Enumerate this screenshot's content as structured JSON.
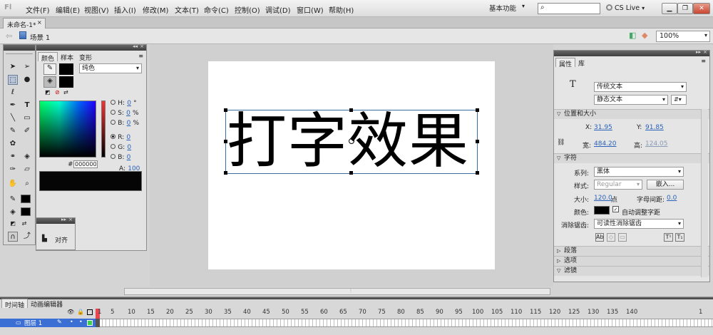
{
  "app": {
    "logo": "Fl",
    "menus": [
      "文件(F)",
      "编辑(E)",
      "视图(V)",
      "插入(I)",
      "修改(M)",
      "文本(T)",
      "命令(C)",
      "控制(O)",
      "调试(D)",
      "窗口(W)",
      "帮助(H)"
    ],
    "workspace": "基本功能",
    "cslive": "CS Live"
  },
  "document": {
    "tab": "未命名-1*",
    "scene": "场景 1",
    "zoom": "100%"
  },
  "color_panel": {
    "tabs": [
      "颜色",
      "样本",
      "变形"
    ],
    "fill_type": "纯色",
    "hsb": [
      {
        "k": "H:",
        "v": "0",
        "u": "°"
      },
      {
        "k": "S:",
        "v": "0",
        "u": "%"
      },
      {
        "k": "B:",
        "v": "0",
        "u": "%"
      }
    ],
    "rgb": [
      {
        "k": "R:",
        "v": "0"
      },
      {
        "k": "G:",
        "v": "0"
      },
      {
        "k": "B:",
        "v": "0"
      }
    ],
    "alpha_label": "A:",
    "alpha": "100",
    "alpha_unit": "%",
    "hex_prefix": "#",
    "hex": "000000",
    "align_label": "对齐"
  },
  "stage": {
    "text": "打字效果"
  },
  "properties": {
    "tabs": [
      "属性",
      "库"
    ],
    "text_engine": "传统文本",
    "text_type": "静态文本",
    "section_pos": "位置和大小",
    "x_label": "X:",
    "x": "31.95",
    "y_label": "Y:",
    "y": "91.85",
    "w_label": "宽:",
    "w": "484.20",
    "h_label": "高:",
    "h": "124.05",
    "section_char": "字符",
    "family_label": "系列:",
    "family": "黑体",
    "style_label": "样式:",
    "style": "Regular",
    "embed": "嵌入...",
    "size_label": "大小:",
    "size": "120.0",
    "size_unit": "点",
    "spacing_label": "字母间距:",
    "spacing": "0.0",
    "color_label": "颜色:",
    "kerning": "自动调整字距",
    "aa_label": "消除锯齿:",
    "aa": "可读性消除锯齿",
    "sections": [
      "段落",
      "选项",
      "滤镜"
    ]
  },
  "timeline": {
    "tabs": [
      "时间轴",
      "动画编辑器"
    ],
    "layer": "图层 1",
    "frames": [
      "1",
      "5",
      "10",
      "15",
      "20",
      "25",
      "30",
      "35",
      "40",
      "45",
      "50",
      "55",
      "60",
      "65",
      "70",
      "75",
      "80",
      "85",
      "90",
      "95",
      "100",
      "105",
      "110",
      "115",
      "120",
      "125",
      "130",
      "135",
      "140",
      "1"
    ]
  },
  "colors": {
    "accent": "#3b6fd4",
    "panel_header": "#4a4a4a",
    "link": "#2a62b8"
  }
}
